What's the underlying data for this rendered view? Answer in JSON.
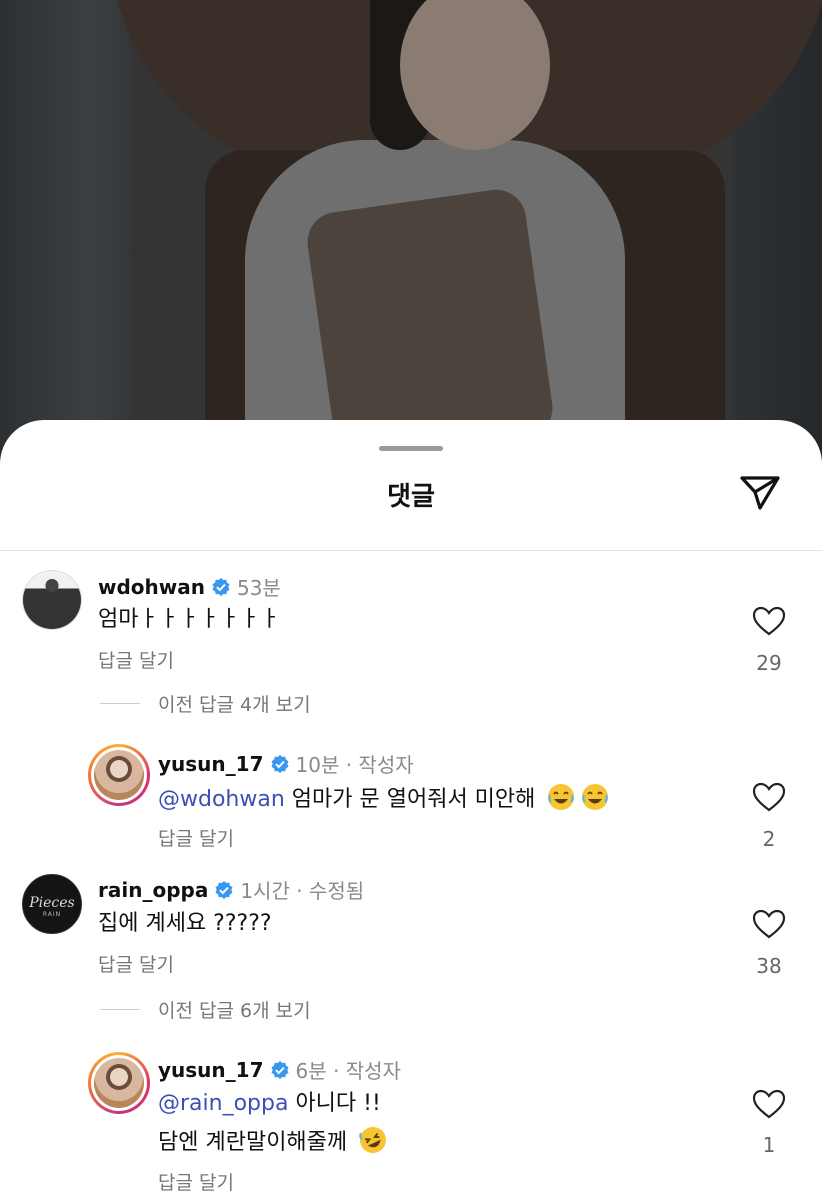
{
  "sheet": {
    "title": "댓글",
    "share_icon": "send-icon"
  },
  "colors": {
    "mention": "#3b4fb8",
    "verified": "#3897f0",
    "muted": "#8a8a8a"
  },
  "comments": [
    {
      "username": "wdohwan",
      "time": "53분",
      "text": "엄마ㅏㅏㅏㅏㅏㅏㅏ",
      "reply_label": "답글 달기",
      "likes": "29",
      "view_replies": "이전 답글 4개 보기",
      "reply": {
        "username": "yusun_17",
        "meta": "10분 · 작성자",
        "mention": "@wdohwan",
        "text": " 엄마가 문 열어줘서 미안해",
        "emoji": [
          "face-with-tears-of-joy",
          "face-with-tears-of-joy"
        ],
        "reply_label": "답글 달기",
        "likes": "2"
      }
    },
    {
      "username": "rain_oppa",
      "time": "1시간 · 수정됨",
      "text": "집에 계세요 ?????",
      "reply_label": "답글 달기",
      "likes": "38",
      "avatar_text": "Pieces",
      "avatar_sub": "RAIN",
      "view_replies": "이전 답글 6개 보기",
      "reply": {
        "username": "yusun_17",
        "meta": "6분 · 작성자",
        "mention": "@rain_oppa",
        "text": " 아니다 !!",
        "text2": "담엔 계란말이해줄께",
        "emoji": [
          "rolling-on-the-floor-laughing"
        ],
        "reply_label": "답글 달기",
        "likes": "1"
      }
    }
  ]
}
